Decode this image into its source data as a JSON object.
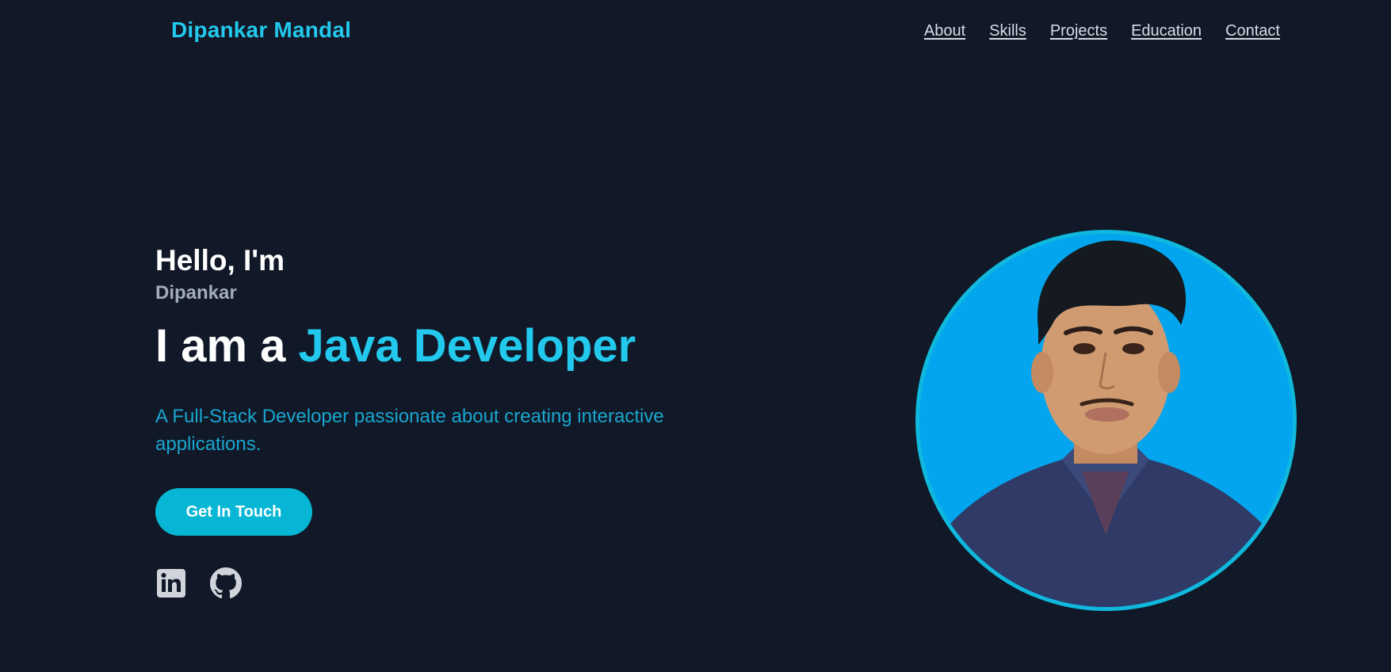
{
  "header": {
    "brand": "Dipankar Mandal",
    "nav": [
      "About",
      "Skills",
      "Projects",
      "Education",
      "Contact"
    ]
  },
  "hero": {
    "greeting": "Hello, I'm",
    "name": "Dipankar",
    "headline_prefix": "I am a ",
    "headline_role": "Java Developer",
    "tagline": "A Full-Stack Developer passionate about creating interactive applications.",
    "cta_label": "Get In Touch",
    "social_icons": [
      "linkedin-icon",
      "github-icon"
    ]
  },
  "colors": {
    "background": "#111827",
    "accent": "#22c9ec",
    "button": "#06b6d4",
    "photo_background": "#03a5ee"
  }
}
